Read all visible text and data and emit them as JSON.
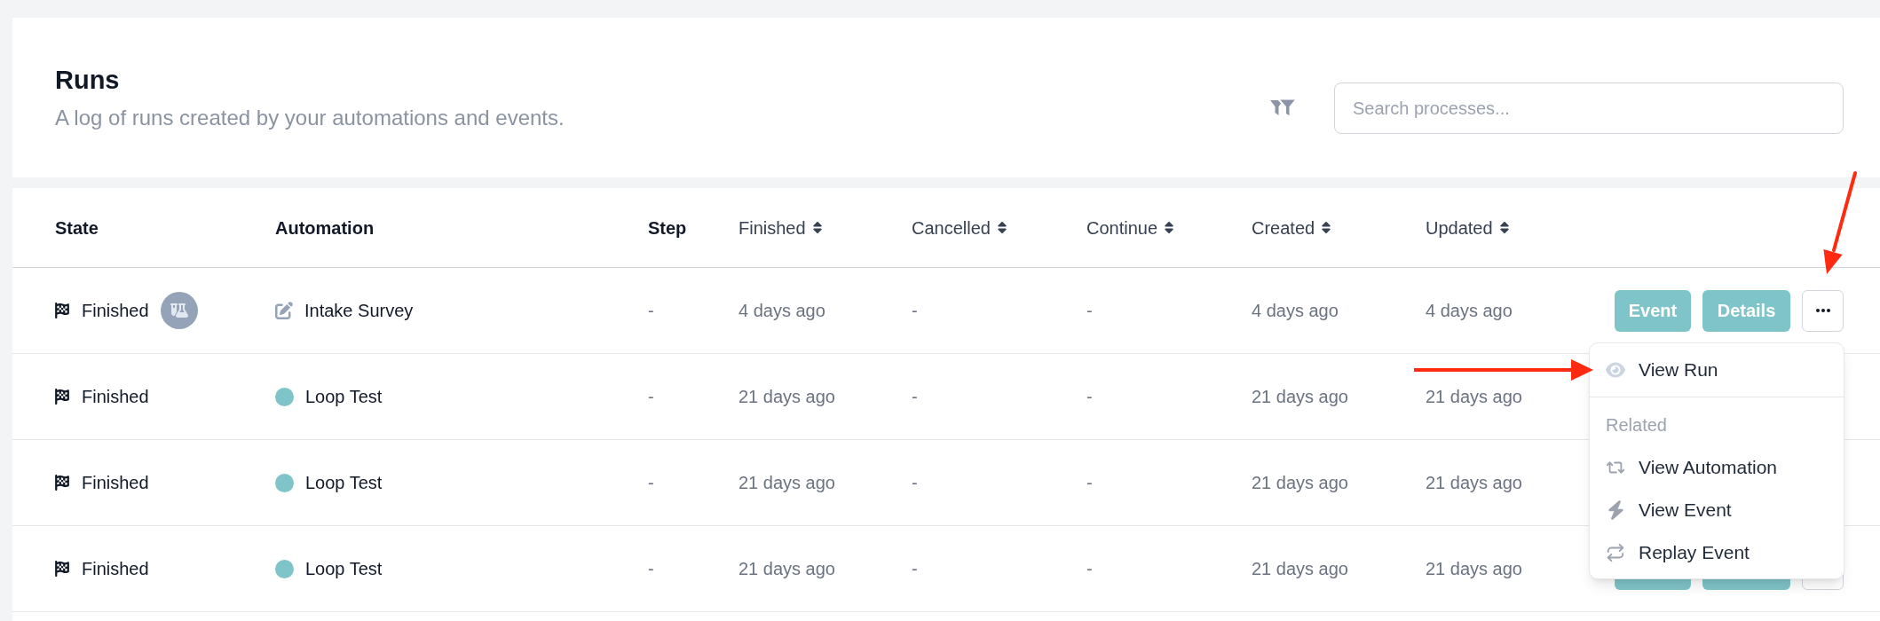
{
  "header": {
    "title": "Runs",
    "subtitle": "A log of runs created by your automations and events.",
    "search": {
      "placeholder": "Search processes..."
    }
  },
  "table": {
    "columns": [
      {
        "label": "State",
        "sortable": false
      },
      {
        "label": "Automation",
        "sortable": false
      },
      {
        "label": "Step",
        "sortable": false
      },
      {
        "label": "Finished",
        "sortable": true
      },
      {
        "label": "Cancelled",
        "sortable": true
      },
      {
        "label": "Continue",
        "sortable": true
      },
      {
        "label": "Created",
        "sortable": true
      },
      {
        "label": "Updated",
        "sortable": true
      }
    ],
    "rows": [
      {
        "state": "Finished",
        "test_run": true,
        "automation": {
          "name": "Intake Survey",
          "kind": "edit"
        },
        "step": "-",
        "finished": "4 days ago",
        "cancelled": "-",
        "continue": "-",
        "created": "4 days ago",
        "updated": "4 days ago",
        "actions": [
          {
            "kind": "event",
            "label": "Event"
          },
          {
            "kind": "details",
            "label": "Details"
          },
          {
            "kind": "more"
          }
        ]
      },
      {
        "state": "Finished",
        "test_run": false,
        "automation": {
          "name": "Loop Test",
          "kind": "dot"
        },
        "step": "-",
        "finished": "21 days ago",
        "cancelled": "-",
        "continue": "-",
        "created": "21 days ago",
        "updated": "21 days ago"
      },
      {
        "state": "Finished",
        "test_run": false,
        "automation": {
          "name": "Loop Test",
          "kind": "dot"
        },
        "step": "-",
        "finished": "21 days ago",
        "cancelled": "-",
        "continue": "-",
        "created": "21 days ago",
        "updated": "21 days ago"
      },
      {
        "state": "Finished",
        "test_run": false,
        "automation": {
          "name": "Loop Test",
          "kind": "dot"
        },
        "step": "-",
        "finished": "21 days ago",
        "cancelled": "-",
        "continue": "-",
        "created": "21 days ago",
        "updated": "21 days ago",
        "actions": [
          {
            "kind": "event"
          },
          {
            "kind": "details"
          },
          {
            "kind": "more"
          }
        ]
      }
    ]
  },
  "menu": {
    "items": [
      {
        "kind": "view_run",
        "label": "View Run"
      }
    ],
    "section": "Related",
    "related": [
      {
        "kind": "view_automation",
        "label": "View Automation"
      },
      {
        "kind": "view_event",
        "label": "View Event"
      },
      {
        "kind": "replay_event",
        "label": "Replay Event"
      }
    ]
  }
}
